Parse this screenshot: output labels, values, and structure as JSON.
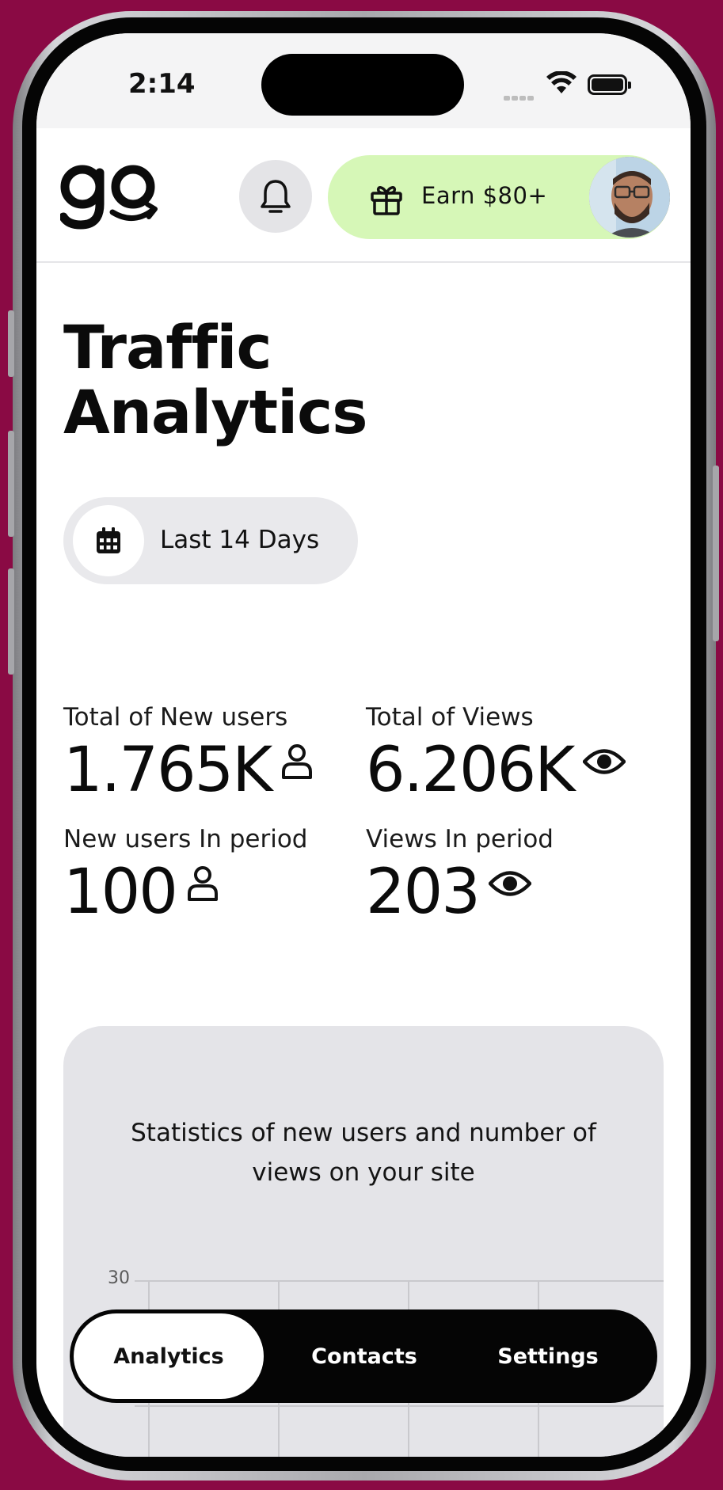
{
  "status_bar": {
    "time": "2:14"
  },
  "header": {
    "logo_text": "go",
    "earn_label": "Earn $80+"
  },
  "page": {
    "title_line1": "Traffic",
    "title_line2": "Analytics",
    "date_range": "Last 14 Days"
  },
  "stats": {
    "total_new_users": {
      "label": "Total of New users",
      "value": "1.765K",
      "icon": "user-icon"
    },
    "total_views": {
      "label": "Total of Views",
      "value": "6.206K",
      "icon": "eye-icon"
    },
    "new_users_period": {
      "label": "New users In period",
      "value": "100",
      "icon": "user-icon"
    },
    "views_period": {
      "label": "Views In period",
      "value": "203",
      "icon": "eye-icon"
    }
  },
  "chart": {
    "caption": "Statistics of new users and number of views on your site"
  },
  "chart_data": {
    "type": "line",
    "title": "",
    "xlabel": "",
    "ylabel": "",
    "y_ticks": [
      "30"
    ],
    "grid": true,
    "series": []
  },
  "tabs": [
    {
      "label": "Analytics",
      "active": true
    },
    {
      "label": "Contacts",
      "active": false
    },
    {
      "label": "Settings",
      "active": false
    }
  ],
  "colors": {
    "background": "#8a0a44",
    "earn_pill": "#d6f7b7",
    "tabbar": "#050505",
    "card": "#e4e4e8"
  }
}
